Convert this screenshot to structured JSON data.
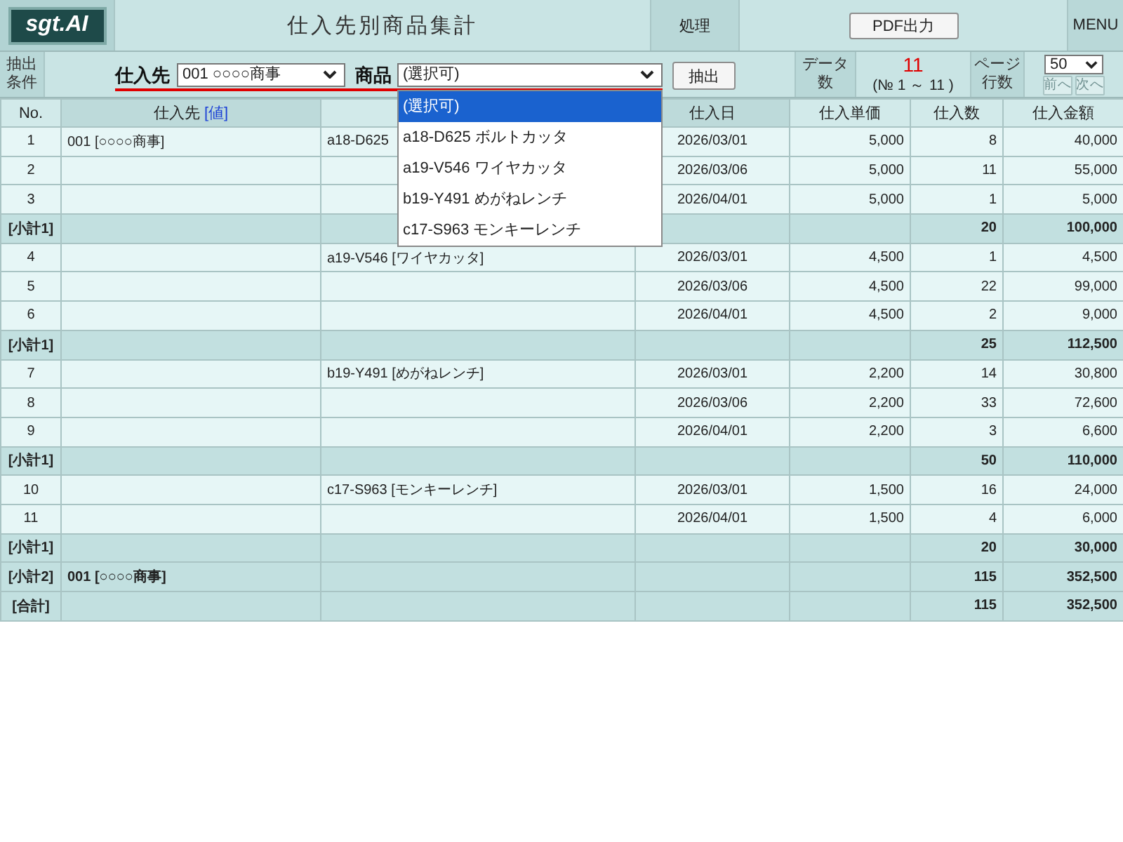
{
  "header": {
    "logo": "sgt.AI",
    "title": "仕入先別商品集計",
    "section": "処理",
    "pdf_button": "PDF出力",
    "menu": "MENU"
  },
  "filter": {
    "label": "抽出条件",
    "supplier": {
      "label": "仕入先",
      "value": "001 ○○○○商事"
    },
    "product": {
      "label": "商品",
      "value": "(選択可)",
      "expanded": true,
      "options": [
        {
          "label": "(選択可)",
          "selected": true
        },
        {
          "label": "a18-D625 ボルトカッタ",
          "selected": false
        },
        {
          "label": "a19-V546 ワイヤカッタ",
          "selected": false
        },
        {
          "label": "b19-Y491 めがねレンチ",
          "selected": false
        },
        {
          "label": "c17-S963 モンキーレンチ",
          "selected": false
        }
      ]
    },
    "extract_button": "抽出"
  },
  "summary": {
    "count_label": "データ数",
    "count": "11",
    "range": "(№ 1 ～ 11 )",
    "rows_label": "ページ行数",
    "page_size": "50",
    "prev_button": {
      "label": "前へ",
      "disabled": true
    },
    "next_button": {
      "label": "次へ",
      "disabled": true
    }
  },
  "table": {
    "columns": [
      {
        "label": "No.",
        "shaded": false
      },
      {
        "label": "仕入先",
        "tag": "[値]",
        "shaded": true
      },
      {
        "shaded": false
      },
      {
        "label": "仕入日",
        "shaded": true
      },
      {
        "label": "仕入単価",
        "shaded": false
      },
      {
        "label": "仕入数",
        "shaded": false
      },
      {
        "label": "仕入金額",
        "shaded": false
      }
    ],
    "rows": [
      {
        "kind": "item",
        "no": "1",
        "supplier": "001 [○○○○商事]",
        "column_3": "a18-D625",
        "date": "2026/03/01",
        "unit_price": "5,000",
        "quantity": "8",
        "amount": "40,000"
      },
      {
        "kind": "item",
        "no": "2",
        "date": "2026/03/06",
        "unit_price": "5,000",
        "quantity": "11",
        "amount": "55,000"
      },
      {
        "kind": "item",
        "no": "3",
        "date": "2026/04/01",
        "unit_price": "5,000",
        "quantity": "1",
        "amount": "5,000"
      },
      {
        "kind": "subtotal",
        "no": "[小計1]",
        "quantity": "20",
        "amount": "100,000"
      },
      {
        "kind": "item",
        "no": "4",
        "column_3": "a19-V546 [ワイヤカッタ]",
        "date": "2026/03/01",
        "unit_price": "4,500",
        "quantity": "1",
        "amount": "4,500"
      },
      {
        "kind": "item",
        "no": "5",
        "date": "2026/03/06",
        "unit_price": "4,500",
        "quantity": "22",
        "amount": "99,000"
      },
      {
        "kind": "item",
        "no": "6",
        "date": "2026/04/01",
        "unit_price": "4,500",
        "quantity": "2",
        "amount": "9,000"
      },
      {
        "kind": "subtotal",
        "no": "[小計1]",
        "quantity": "25",
        "amount": "112,500"
      },
      {
        "kind": "item",
        "no": "7",
        "column_3": "b19-Y491 [めがねレンチ]",
        "date": "2026/03/01",
        "unit_price": "2,200",
        "quantity": "14",
        "amount": "30,800"
      },
      {
        "kind": "item",
        "no": "8",
        "date": "2026/03/06",
        "unit_price": "2,200",
        "quantity": "33",
        "amount": "72,600"
      },
      {
        "kind": "item",
        "no": "9",
        "date": "2026/04/01",
        "unit_price": "2,200",
        "quantity": "3",
        "amount": "6,600"
      },
      {
        "kind": "subtotal",
        "no": "[小計1]",
        "quantity": "50",
        "amount": "110,000"
      },
      {
        "kind": "item",
        "no": "10",
        "column_3": "c17-S963 [モンキーレンチ]",
        "date": "2026/03/01",
        "unit_price": "1,500",
        "quantity": "16",
        "amount": "24,000"
      },
      {
        "kind": "item",
        "no": "11",
        "date": "2026/04/01",
        "unit_price": "1,500",
        "quantity": "4",
        "amount": "6,000"
      },
      {
        "kind": "subtotal",
        "no": "[小計1]",
        "quantity": "20",
        "amount": "30,000"
      },
      {
        "kind": "subtotal",
        "no": "[小計2]",
        "supplier": "001 [○○○○商事]",
        "quantity": "115",
        "amount": "352,500"
      },
      {
        "kind": "subtotal",
        "no": "[合計]",
        "quantity": "115",
        "amount": "352,500"
      }
    ]
  }
}
